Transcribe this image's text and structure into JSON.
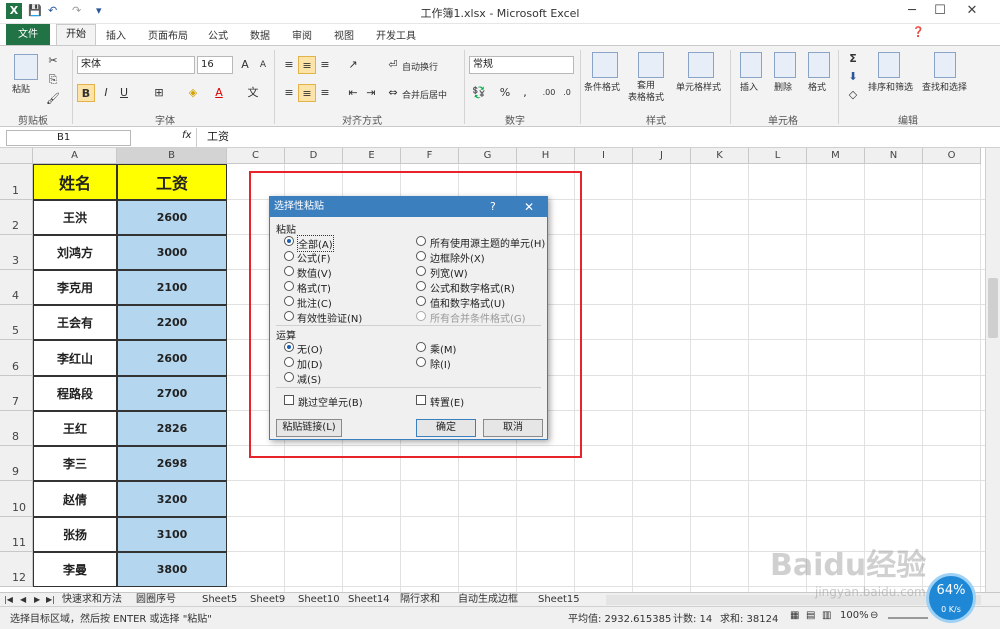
{
  "window": {
    "title": "工作簿1.xlsx - Microsoft Excel",
    "app_icon": "excel-icon"
  },
  "ribbon_tabs": [
    "文件",
    "开始",
    "插入",
    "页面布局",
    "公式",
    "数据",
    "审阅",
    "视图",
    "开发工具"
  ],
  "ribbon": {
    "clipboard": {
      "label": "剪贴板",
      "paste": "粘贴"
    },
    "font": {
      "label": "字体",
      "name": "宋体",
      "size": "16",
      "bold": "B",
      "italic": "I",
      "underline": "U"
    },
    "align": {
      "label": "对齐方式",
      "wrap": "自动换行",
      "merge": "合并后居中"
    },
    "number": {
      "label": "数字",
      "format": "常规"
    },
    "styles": {
      "label": "样式",
      "cond": "条件格式",
      "table": "套用\n表格格式",
      "cellstyle": "单元格样式"
    },
    "cells": {
      "label": "单元格",
      "insert": "插入",
      "delete": "删除",
      "format": "格式"
    },
    "edit": {
      "label": "编辑",
      "sort": "排序和筛选",
      "find": "查找和选择"
    }
  },
  "formula_bar": {
    "name_box": "B1",
    "fx": "fx",
    "content": "工资"
  },
  "columns": [
    "A",
    "B",
    "C",
    "D",
    "E",
    "F",
    "G",
    "H",
    "I",
    "J",
    "K",
    "L",
    "M",
    "N",
    "O"
  ],
  "rows": [
    "1",
    "2",
    "3",
    "4",
    "5",
    "6",
    "7",
    "8",
    "9",
    "10",
    "11",
    "12"
  ],
  "table": {
    "header": [
      "姓名",
      "工资"
    ],
    "rows": [
      [
        "王洪",
        "2600"
      ],
      [
        "刘鸿方",
        "3000"
      ],
      [
        "李克用",
        "2100"
      ],
      [
        "王会有",
        "2200"
      ],
      [
        "李红山",
        "2600"
      ],
      [
        "程路段",
        "2700"
      ],
      [
        "王红",
        "2826"
      ],
      [
        "李三",
        "2698"
      ],
      [
        "赵倩",
        "3200"
      ],
      [
        "张扬",
        "3100"
      ],
      [
        "李曼",
        "3800"
      ]
    ]
  },
  "dialog": {
    "title": "选择性粘贴",
    "help": "?",
    "close": "✕",
    "paste_label": "粘贴",
    "paste_left": [
      "全部(A)",
      "公式(F)",
      "数值(V)",
      "格式(T)",
      "批注(C)",
      "有效性验证(N)"
    ],
    "paste_right": [
      "所有使用源主题的单元(H)",
      "边框除外(X)",
      "列宽(W)",
      "公式和数字格式(R)",
      "值和数字格式(U)",
      "所有合并条件格式(G)"
    ],
    "op_label": "运算",
    "op_left": [
      "无(O)",
      "加(D)",
      "减(S)"
    ],
    "op_right": [
      "乘(M)",
      "除(I)"
    ],
    "skip_blanks": "跳过空单元(B)",
    "transpose": "转置(E)",
    "paste_link": "粘贴链接(L)",
    "ok": "确定",
    "cancel": "取消"
  },
  "sheets": [
    "快速求和方法",
    "圆圈序号",
    "Sheet5",
    "Sheet9",
    "Sheet10",
    "Sheet14",
    "隔行求和",
    "自动生成边框",
    "Sheet15"
  ],
  "status": {
    "message": "选择目标区域，然后按 ENTER 或选择 \"粘贴\"",
    "average": "平均值: 2932.615385",
    "count": "计数: 14",
    "sum": "求和: 38124",
    "zoom": "100%",
    "speed": "64%",
    "speed_rate": "0 K/s"
  },
  "watermark": {
    "brand": "Baidu经验",
    "url": "jingyan.baidu.com"
  }
}
